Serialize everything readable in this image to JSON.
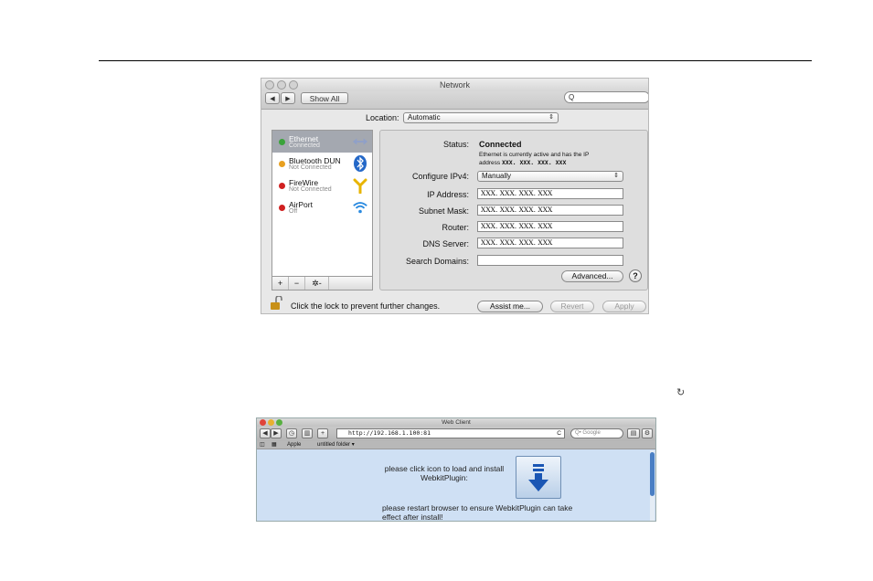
{
  "network": {
    "title": "Network",
    "show_all": "Show All",
    "search_glyph": "Q",
    "location_label": "Location:",
    "location_value": "Automatic",
    "services": [
      {
        "name": "Ethernet",
        "status": "Connected",
        "dot": "#3aa33a"
      },
      {
        "name": "Bluetooth DUN",
        "status": "Not Connected",
        "dot": "#e8a020"
      },
      {
        "name": "FireWire",
        "status": "Not Connected",
        "dot": "#d02020"
      },
      {
        "name": "AirPort",
        "status": "Off",
        "dot": "#d02020"
      }
    ],
    "list_controls": {
      "add": "+",
      "remove": "−",
      "action": "✲-"
    },
    "status_label": "Status:",
    "status_value": "Connected",
    "status_desc_1": "Ethernet is currently active and has the IP",
    "status_desc_2": "address",
    "status_desc_ip": "XXX. XXX. XXX. XXX",
    "configure_label": "Configure IPv4:",
    "configure_value": "Manually",
    "ip_label": "IP Address:",
    "ip_value": "XXX. XXX. XXX. XXX",
    "subnet_label": "Subnet Mask:",
    "subnet_value": "XXX. XXX. XXX. XXX",
    "router_label": "Router:",
    "router_value": "XXX. XXX. XXX. XXX",
    "dns_label": "DNS Server:",
    "dns_value": "XXX. XXX. XXX. XXX",
    "search_domains_label": "Search Domains:",
    "search_domains_value": "",
    "advanced_label": "Advanced...",
    "help_label": "?",
    "lock_text": "Click the lock to prevent further changes.",
    "assist_label": "Assist me...",
    "revert_label": "Revert",
    "apply_label": "Apply"
  },
  "reload_glyph": "↻",
  "web": {
    "title": "Web Client",
    "url": "http://192.168.1.100:81",
    "reload_glyph": "C",
    "google_placeholder": "Q• Google",
    "bookmarks": {
      "reader": "◫",
      "grid": "▦",
      "apple": "Apple",
      "folder": "untitled folder ▾"
    },
    "msg_install_1": "please click icon to load and install",
    "msg_install_2": "WebkitPlugin:",
    "msg_restart_1": "please restart browser to ensure WebkitPlugin can take",
    "msg_restart_2": "effect after install!"
  },
  "colors": {
    "accent": "#4a7fc4",
    "selected_row": "#a4a8b0",
    "content_bg": "#cfe0f4"
  }
}
